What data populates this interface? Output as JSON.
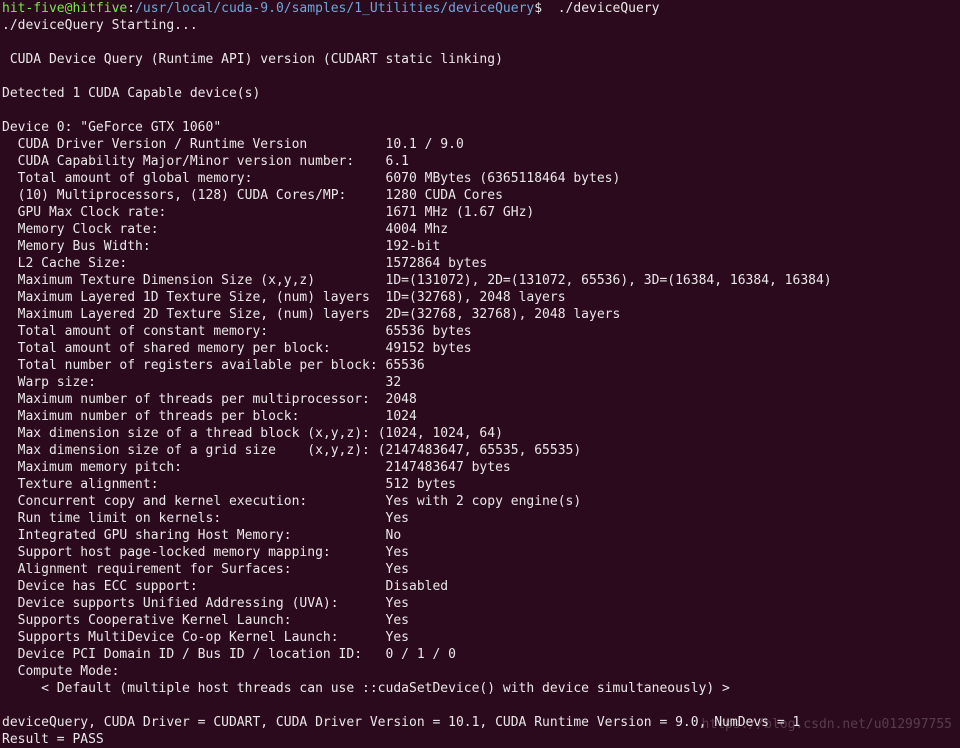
{
  "prompt": {
    "user": "hit-five@hitfive",
    "sep": ":",
    "path": "/usr/local/cuda-9.0/samples/1_Utilities/deviceQuery",
    "dollar": "$",
    "command": "  ./deviceQuery"
  },
  "starting": "./deviceQuery Starting...",
  "header": " CUDA Device Query (Runtime API) version (CUDART static linking)",
  "detected": "Detected 1 CUDA Capable device(s)",
  "device_line": "Device 0: \"GeForce GTX 1060\"",
  "props": [
    {
      "label": "  CUDA Driver Version / Runtime Version",
      "value": "10.1 / 9.0"
    },
    {
      "label": "  CUDA Capability Major/Minor version number:",
      "value": "6.1"
    },
    {
      "label": "  Total amount of global memory:",
      "value": "6070 MBytes (6365118464 bytes)"
    },
    {
      "label": "  (10) Multiprocessors, (128) CUDA Cores/MP:",
      "value": "1280 CUDA Cores"
    },
    {
      "label": "  GPU Max Clock rate:",
      "value": "1671 MHz (1.67 GHz)"
    },
    {
      "label": "  Memory Clock rate:",
      "value": "4004 Mhz"
    },
    {
      "label": "  Memory Bus Width:",
      "value": "192-bit"
    },
    {
      "label": "  L2 Cache Size:",
      "value": "1572864 bytes"
    },
    {
      "label": "  Maximum Texture Dimension Size (x,y,z)",
      "value": "1D=(131072), 2D=(131072, 65536), 3D=(16384, 16384, 16384)"
    },
    {
      "label": "  Maximum Layered 1D Texture Size, (num) layers",
      "value": "1D=(32768), 2048 layers"
    },
    {
      "label": "  Maximum Layered 2D Texture Size, (num) layers",
      "value": "2D=(32768, 32768), 2048 layers"
    },
    {
      "label": "  Total amount of constant memory:",
      "value": "65536 bytes"
    },
    {
      "label": "  Total amount of shared memory per block:",
      "value": "49152 bytes"
    },
    {
      "label": "  Total number of registers available per block:",
      "value": "65536"
    },
    {
      "label": "  Warp size:",
      "value": "32"
    },
    {
      "label": "  Maximum number of threads per multiprocessor:",
      "value": "2048"
    },
    {
      "label": "  Maximum number of threads per block:",
      "value": "1024"
    },
    {
      "label": "  Max dimension size of a thread block (x,y,z):",
      "value": "(1024, 1024, 64)",
      "nopad": true
    },
    {
      "label": "  Max dimension size of a grid size    (x,y,z):",
      "value": "(2147483647, 65535, 65535)",
      "nopad": true
    },
    {
      "label": "  Maximum memory pitch:",
      "value": "2147483647 bytes"
    },
    {
      "label": "  Texture alignment:",
      "value": "512 bytes"
    },
    {
      "label": "  Concurrent copy and kernel execution:",
      "value": "Yes with 2 copy engine(s)"
    },
    {
      "label": "  Run time limit on kernels:",
      "value": "Yes"
    },
    {
      "label": "  Integrated GPU sharing Host Memory:",
      "value": "No"
    },
    {
      "label": "  Support host page-locked memory mapping:",
      "value": "Yes"
    },
    {
      "label": "  Alignment requirement for Surfaces:",
      "value": "Yes"
    },
    {
      "label": "  Device has ECC support:",
      "value": "Disabled"
    },
    {
      "label": "  Device supports Unified Addressing (UVA):",
      "value": "Yes"
    },
    {
      "label": "  Supports Cooperative Kernel Launch:",
      "value": "Yes"
    },
    {
      "label": "  Supports MultiDevice Co-op Kernel Launch:",
      "value": "Yes"
    },
    {
      "label": "  Device PCI Domain ID / Bus ID / location ID:",
      "value": "0 / 1 / 0"
    }
  ],
  "compute_mode_label": "  Compute Mode:",
  "compute_mode_value": "     < Default (multiple host threads can use ::cudaSetDevice() with device simultaneously) >",
  "summary": "deviceQuery, CUDA Driver = CUDART, CUDA Driver Version = 10.1, CUDA Runtime Version = 9.0, NumDevs = 1",
  "result": "Result = PASS",
  "watermark": "https://blog.csdn.net/u012997755",
  "label_column_width": 49
}
